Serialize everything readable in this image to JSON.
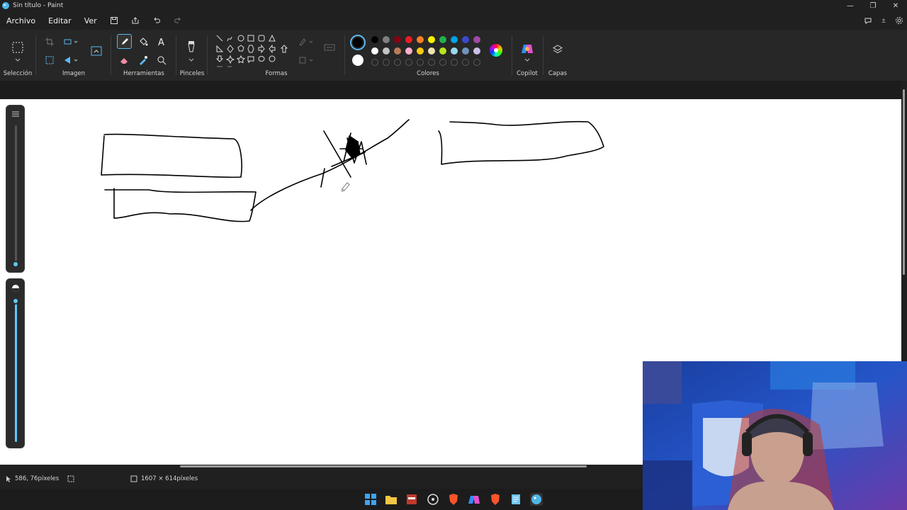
{
  "window": {
    "title": "Sin título - Paint"
  },
  "menu": {
    "items": [
      "Archivo",
      "Editar",
      "Ver"
    ]
  },
  "ribbon": {
    "groups": {
      "selection": "Selección",
      "image": "Imagen",
      "tools": "Herramientas",
      "brushes": "Pinceles",
      "shapes": "Formas",
      "colors": "Colores",
      "copilot": "Copilot",
      "layers": "Capas"
    }
  },
  "palette": {
    "primary": "#000000",
    "secondary": "#ffffff",
    "row1": [
      "#000000",
      "#7f7f7f",
      "#880015",
      "#ed1c24",
      "#ff7f27",
      "#fff200",
      "#22b14c",
      "#00a2e8",
      "#3f48cc",
      "#a349a4"
    ],
    "row2": [
      "#ffffff",
      "#c3c3c3",
      "#b97a57",
      "#ffaec9",
      "#ffc90e",
      "#efe4b0",
      "#b5e61d",
      "#99d9ea",
      "#7092be",
      "#c8bfe7"
    ]
  },
  "status": {
    "cursor_position": "586, 76píxeles",
    "canvas_size": "1607 × 614píxeles"
  }
}
